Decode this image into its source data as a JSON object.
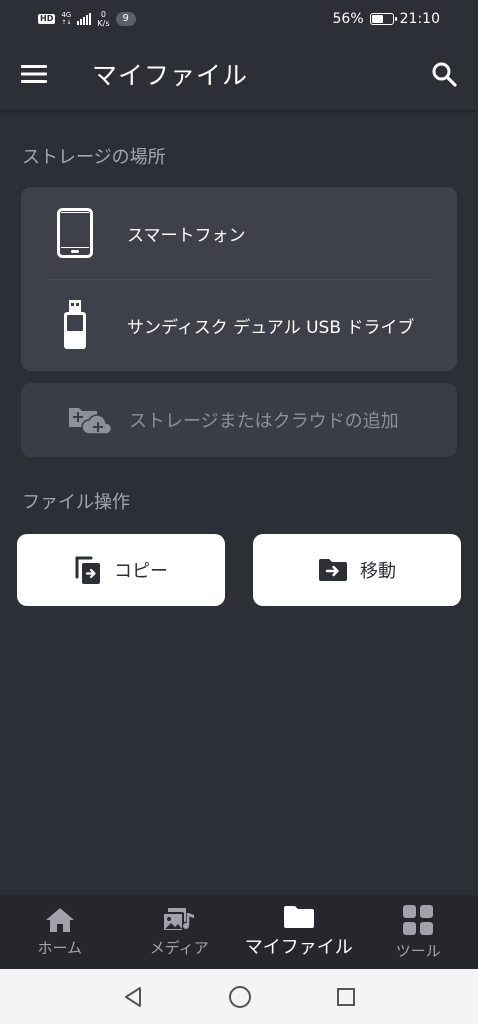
{
  "status_bar": {
    "hd": "HD",
    "network": "4G",
    "speed_value": "0",
    "speed_unit": "K/s",
    "notification_count": "9",
    "battery_percent": "56%",
    "battery_level": 0.56,
    "time": "21:10"
  },
  "app_bar": {
    "title": "マイファイル"
  },
  "storage": {
    "section_title": "ストレージの場所",
    "items": [
      {
        "label": "スマートフォン",
        "icon": "smartphone-icon"
      },
      {
        "label": "サンディスク デュアル USB ドライブ",
        "icon": "usb-drive-icon"
      }
    ],
    "add_label": "ストレージまたはクラウドの追加"
  },
  "file_ops": {
    "section_title": "ファイル操作",
    "copy_label": "コピー",
    "move_label": "移動"
  },
  "bottom_nav": {
    "items": [
      {
        "label": "ホーム",
        "icon": "home-icon"
      },
      {
        "label": "メディア",
        "icon": "media-icon"
      },
      {
        "label": "マイファイル",
        "icon": "folder-icon"
      },
      {
        "label": "ツール",
        "icon": "grid-icon"
      }
    ],
    "active_index": 2
  },
  "colors": {
    "background": "#2c2f36",
    "card": "#3e414a",
    "bottom_nav": "#25272d",
    "muted_text": "#a3a7ad"
  }
}
